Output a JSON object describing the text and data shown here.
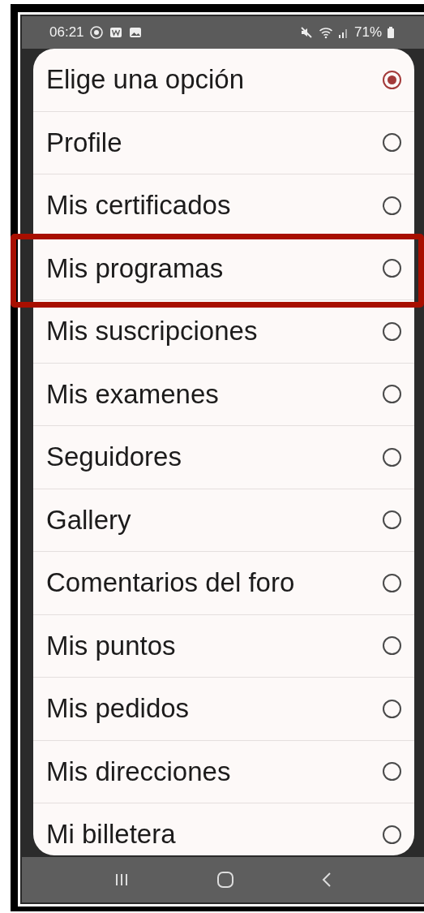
{
  "status_bar": {
    "time": "06:21",
    "battery": "71%"
  },
  "options": [
    {
      "label": "Elige una opción",
      "selected": true,
      "highlighted": false
    },
    {
      "label": "Profile",
      "selected": false,
      "highlighted": false
    },
    {
      "label": "Mis certificados",
      "selected": false,
      "highlighted": false
    },
    {
      "label": "Mis programas",
      "selected": false,
      "highlighted": true
    },
    {
      "label": "Mis suscripciones",
      "selected": false,
      "highlighted": false
    },
    {
      "label": "Mis examenes",
      "selected": false,
      "highlighted": false
    },
    {
      "label": "Seguidores",
      "selected": false,
      "highlighted": false
    },
    {
      "label": "Gallery",
      "selected": false,
      "highlighted": false
    },
    {
      "label": "Comentarios del foro",
      "selected": false,
      "highlighted": false
    },
    {
      "label": "Mis puntos",
      "selected": false,
      "highlighted": false
    },
    {
      "label": "Mis pedidos",
      "selected": false,
      "highlighted": false
    },
    {
      "label": "Mis direcciones",
      "selected": false,
      "highlighted": false
    },
    {
      "label": "Mi billetera",
      "selected": false,
      "highlighted": false
    }
  ]
}
